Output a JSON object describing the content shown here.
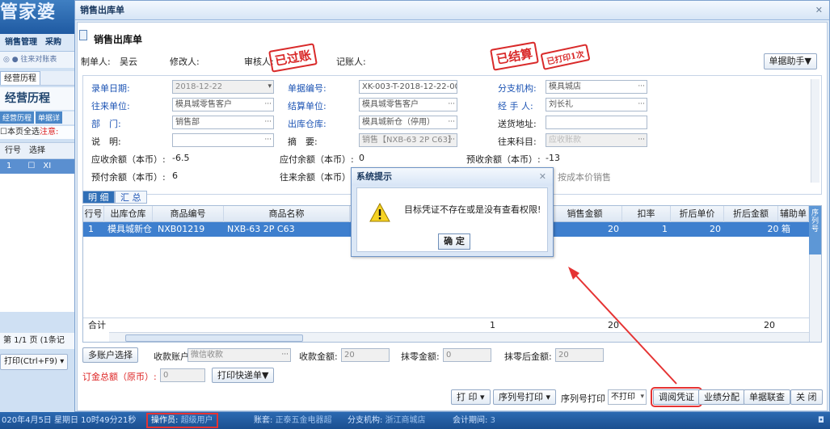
{
  "bg": {
    "logo": "管家婆",
    "menu": [
      "销售管理",
      "采购"
    ],
    "row2": "◎ ● 往来对账表",
    "tab": "经营历程",
    "title": "经营历程",
    "subtabs": [
      "经营历程",
      "单据详"
    ],
    "check_all": "本页全选",
    "check_note": "注意:",
    "grid_headers": [
      "行号",
      "选择"
    ],
    "grid_row": [
      "1",
      "XI"
    ],
    "page_text": "第 1/1 页 (1条记",
    "print_btn": "打印(Ctrl+F9)"
  },
  "status": {
    "datetime": "020年4月5日 星期日 10时49分21秒",
    "operator_label": "操作员:",
    "operator_value": "超级用户",
    "account_label": "账套:",
    "account_value": "正泰五金电器超",
    "branch_label": "分支机构:",
    "branch_value": "浙江商城店",
    "period_label": "会计期间:",
    "period_value": "3"
  },
  "window": {
    "title": "销售出库单",
    "close": "✕"
  },
  "form": {
    "title": "销售出库单",
    "maker_label": "制单人:",
    "maker_value": "吴云",
    "modifier_label": "修改人:",
    "auditor_label": "审核人:",
    "poster_label": "记账人:",
    "stamp_posted": "已过账",
    "stamp_settled": "已结算",
    "stamp_printed": "已打印1次",
    "helper_btn": "单据助手▼"
  },
  "fields": {
    "date_label": "录单日期:",
    "date_value": "2018-12-22",
    "docno_label": "单据编号:",
    "docno_value": "XK-003-T-2018-12-22-002",
    "branch_label": "分支机构:",
    "branch_value": "模具城店",
    "partner_label": "往来单位:",
    "partner_value": "模具城零售客户",
    "settle_label": "结算单位:",
    "settle_value": "模具城零售客户",
    "handler_label": "经 手 人:",
    "handler_value": "刘长礼",
    "dept_label": "部　门:",
    "dept_value": "销售部",
    "warehouse_label": "出库仓库:",
    "warehouse_value": "模具城新仓（停用）",
    "address_label": "送货地址:",
    "address_value": "",
    "note_label": "说　明:",
    "note_value": "",
    "summary_label": "摘　要:",
    "summary_value": "销售【NXB-63 2P C63】",
    "subject_label": "往来科目:",
    "subject_value": "应收账款",
    "ar_label": "应收余额（本币）:",
    "ar_value": "-6.5",
    "ap_label": "应付余额（本币）:",
    "ap_value": "0",
    "pre_recv_label": "预收余额（本币）:",
    "pre_recv_value": "-13",
    "prepay_label": "预付余额（本币）:",
    "prepay_value": "6",
    "balance_label": "往来余额（本币）:",
    "cost_note": "按成本价销售"
  },
  "tabs": {
    "detail": "明 细",
    "summary": "汇 总"
  },
  "grid": {
    "headers": [
      "行号",
      "出库仓库",
      "商品编号",
      "商品名称",
      "销售金额",
      "扣率",
      "折后单价",
      "折后金额",
      "辅助单"
    ],
    "row": [
      "1",
      "模具城新仓",
      "NXB01219",
      "NXB-63 2P C63",
      "20",
      "1",
      "20",
      "20 箱"
    ],
    "total_label": "合计",
    "total_qty": "1",
    "total_sales": "20",
    "total_discount": "20",
    "serial_col": "序列号"
  },
  "pay": {
    "multi_btn": "多账户选择",
    "account_label": "收款账户:",
    "account_value": "微信收款",
    "amount_label": "收款金额:",
    "amount_value": "20",
    "zero_label": "抹零金额:",
    "zero_value": "0",
    "after_label": "抹零后金额:",
    "after_value": "20",
    "deposit_label": "订金总额（原币）:",
    "deposit_value": "0",
    "express_btn": "打印快递单▼"
  },
  "bottom": {
    "print": "打 印",
    "serial_print": "序列号打印",
    "serial_print_label": "序列号打印",
    "serial_print_value": "不打印",
    "view_voucher": "调阅凭证",
    "perf": "业绩分配",
    "link": "单据联查",
    "close": "关 闭"
  },
  "dialog": {
    "title": "系统提示",
    "close": "✕",
    "message": "目标凭证不存在或是没有查看权限!",
    "ok": "确 定"
  },
  "colors": {
    "accent": "#2f6fb7",
    "highlight_red": "#e53333",
    "stamp_red": "#d92a2a"
  }
}
